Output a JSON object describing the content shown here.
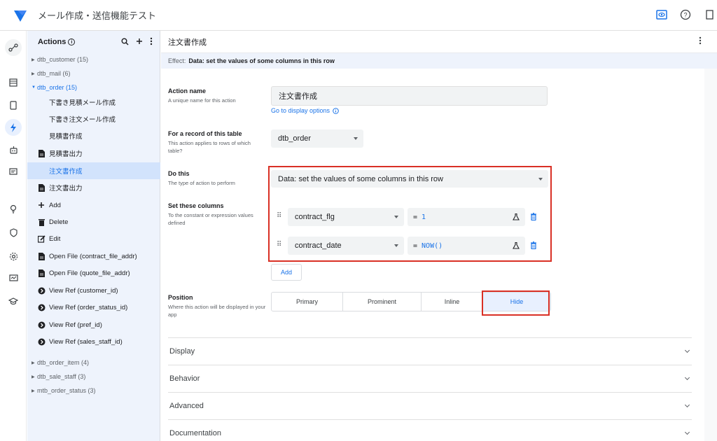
{
  "app": {
    "title": "メール作成・送信機能テスト"
  },
  "panel": {
    "title": "Actions",
    "info": "i",
    "groups_top": [
      {
        "label": "dtb_customer (15)"
      },
      {
        "label": "dtb_mail (6)"
      },
      {
        "label": "dtb_order (15)"
      }
    ],
    "items": [
      {
        "label": "下書き見積メール作成",
        "icon": ""
      },
      {
        "label": "下書き注文メール作成",
        "icon": ""
      },
      {
        "label": "見積書作成",
        "icon": ""
      },
      {
        "label": "見積書出力",
        "icon": "document-icon"
      },
      {
        "label": "注文書作成",
        "icon": ""
      },
      {
        "label": "注文書出力",
        "icon": "document-icon"
      },
      {
        "label": "Add",
        "icon": "plus-icon"
      },
      {
        "label": "Delete",
        "icon": "trash-icon"
      },
      {
        "label": "Edit",
        "icon": "edit-icon"
      },
      {
        "label": "Open File (contract_file_addr)",
        "icon": "document-icon"
      },
      {
        "label": "Open File (quote_file_addr)",
        "icon": "document-icon"
      },
      {
        "label": "View Ref (customer_id)",
        "icon": "view-ref-icon"
      },
      {
        "label": "View Ref (order_status_id)",
        "icon": "view-ref-icon"
      },
      {
        "label": "View Ref (pref_id)",
        "icon": "view-ref-icon"
      },
      {
        "label": "View Ref (sales_staff_id)",
        "icon": "view-ref-icon"
      }
    ],
    "groups_bottom": [
      {
        "label": "dtb_order_item (4)"
      },
      {
        "label": "dtb_sale_staff (3)"
      },
      {
        "label": "mtb_order_status (3)"
      }
    ]
  },
  "main": {
    "title": "注文書作成",
    "effect_label": "Effect:",
    "effect_value": "Data: set the values of some columns in this row",
    "action_name": {
      "label": "Action name",
      "help": "A unique name for this action",
      "value": "注文書作成",
      "link": "Go to display options"
    },
    "record": {
      "label": "For a record of this table",
      "help": "This action applies to rows of which table?",
      "value": "dtb_order"
    },
    "do_this": {
      "label": "Do this",
      "help": "The type of action to perform",
      "value": "Data: set the values of some columns in this row"
    },
    "set_columns": {
      "label": "Set these columns",
      "help": "To the constant or expression values defined",
      "rows": [
        {
          "column": "contract_flg",
          "op": "=",
          "value": "1"
        },
        {
          "column": "contract_date",
          "op": "=",
          "value": "NOW()"
        }
      ],
      "add_label": "Add"
    },
    "position": {
      "label": "Position",
      "help": "Where this action will be displayed in your app",
      "options": [
        "Primary",
        "Prominent",
        "Inline",
        "Hide"
      ],
      "selected": "Hide"
    },
    "sections": [
      "Display",
      "Behavior",
      "Advanced",
      "Documentation"
    ]
  },
  "colors": {
    "accent": "#1a73e8",
    "highlight": "#d93025",
    "panel_bg": "#eef3fc",
    "selected_bg": "#d2e3fc"
  }
}
